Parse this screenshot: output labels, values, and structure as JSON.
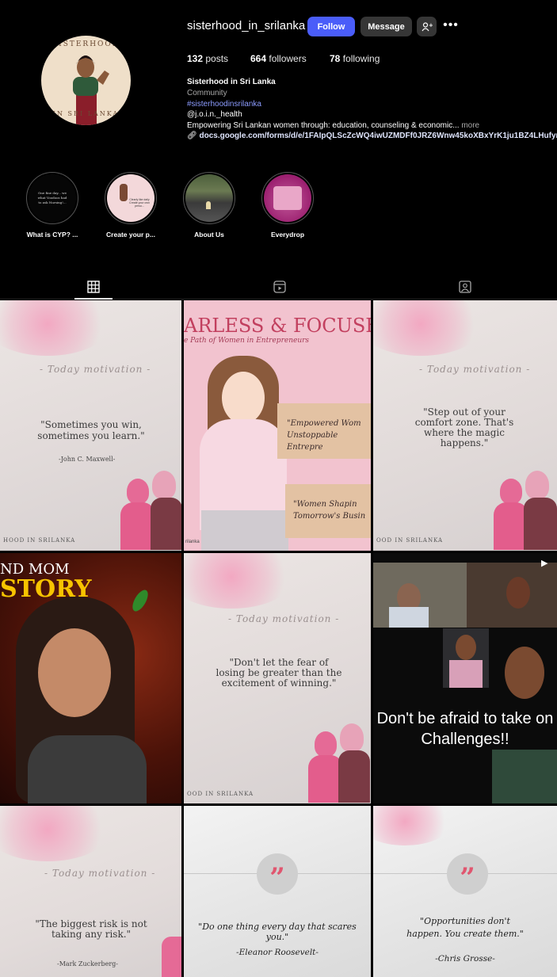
{
  "profile": {
    "username": "sisterhood_in_srilanka",
    "follow_label": "Follow",
    "message_label": "Message",
    "add_person_label": "+",
    "avatar_text_top": "SISTERHOOD",
    "avatar_text_bottom": "IN SRI LANKA",
    "stats": {
      "posts_count": "132",
      "posts_label": "posts",
      "followers_count": "664",
      "followers_label": "followers",
      "following_count": "78",
      "following_label": "following"
    },
    "bio": {
      "name": "Sisterhood in Sri Lanka",
      "category": "Community",
      "hashtag": "#sisterhoodinsrilanka",
      "mention": "@j.o.i.n._health",
      "description": "Empowering Sri Lankan women through: education, counseling & economic...",
      "more_label": "more",
      "link": "docs.google.com/forms/d/e/1FAIpQLScZcWQ4iwUZMDFf0JRZ6Wnw45koXBxYrK1ju1BZ4LHufyr"
    }
  },
  "highlights": [
    {
      "label": "What is CYP? ...",
      "inner_text": "One fine day... we what Voodoos had to ask Nursing!..."
    },
    {
      "label": "Create your p...",
      "inner_text": "Clearly like daily Create your own perso..."
    },
    {
      "label": "About Us",
      "inner_text": ""
    },
    {
      "label": "Everydrop",
      "inner_text": ""
    }
  ],
  "posts": {
    "p1": {
      "today": "- Today motivation -",
      "quote": "\"Sometimes you win, sometimes you learn.\"",
      "author": "-John C. Maxwell-",
      "brand": "HOOD IN SRILANKA"
    },
    "p2": {
      "title": "ARLESS & FOCUSED",
      "subtitle": "e Path of Women in Entrepreneurs",
      "box1": "\"Empowered Wom Unstoppable Entrepre",
      "box2": "\"Women Shapin Tomorrow's Busin",
      "corner": "rilanka"
    },
    "p3": {
      "today": "- Today motivation -",
      "quote": "\"Step out of your comfort zone. That's where the magic happens.\"",
      "brand": "OOD IN SRILANKA"
    },
    "p4": {
      "line1": "ND MOM",
      "line2": "STORY"
    },
    "p5": {
      "today": "- Today motivation -",
      "quote": "\"Don't let the fear of losing be greater than the excitement of winning.\"",
      "brand": "OOD IN SRILANKA"
    },
    "p6": {
      "caption": "Don't be afraid to take on Challenges!!"
    },
    "p7": {
      "today": "- Today motivation -",
      "quote": "\"The biggest risk is not taking any risk.\"",
      "author": "-Mark Zuckerberg-"
    },
    "p8": {
      "quote": "\"Do one thing every day that scares you.\"",
      "author": "-Eleanor Roosevelt-"
    },
    "p9": {
      "quote": "\"Opportunities don't happen. You create them.\"",
      "author": "-Chris Grosse-"
    }
  }
}
